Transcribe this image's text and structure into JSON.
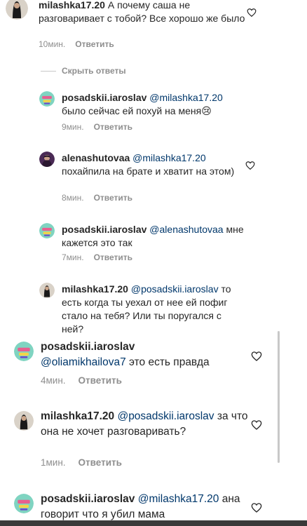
{
  "comments": [
    {
      "user": "milashka17.20",
      "mention": "",
      "text": "А почему саша не разговаривает с тобой? Все хорошо же было",
      "time": "10мин.",
      "reply": "Ответить"
    },
    {
      "user": "posadskii.iaroslav",
      "mention": "@milashka17.20",
      "text": "было сейчас ей похуй на меня😢",
      "time": "9мин.",
      "reply": "Ответить"
    },
    {
      "user": "alenashutovaa",
      "mention": "@milashka17.20",
      "text": "похайпила на брате и хватит на этом)",
      "time": "8мин.",
      "reply": "Ответить"
    },
    {
      "user": "posadskii.iaroslav",
      "mention": "@alenashutovaa",
      "text": "мне кажется это так",
      "time": "7мин.",
      "reply": "Ответить"
    },
    {
      "user": "milashka17.20",
      "mention": "@posadskii.iaroslav",
      "text": "то есть когда ты уехал от нее ей пофиг стало на тебя? Или ты поругался с ней?",
      "time": "",
      "reply": ""
    },
    {
      "user": "posadskii.iaroslav",
      "mention": "@oliamikhailova7",
      "text": "это есть правда",
      "time": "4мин.",
      "reply": "Ответить"
    },
    {
      "user": "milashka17.20",
      "mention": "@posadskii.iaroslav",
      "text": "за что она не хочет разговаривать?",
      "time": "1мин.",
      "reply": "Ответить"
    },
    {
      "user": "posadskii.iaroslav",
      "mention": "@milashka17.20",
      "text": "ана говорит что я убил мама",
      "time": "",
      "reply": ""
    }
  ],
  "hide_replies": "Скрыть ответы",
  "colors": {
    "text": "#262626",
    "mention": "#00376b",
    "meta": "#8e8e8e",
    "heart": "#262626"
  }
}
